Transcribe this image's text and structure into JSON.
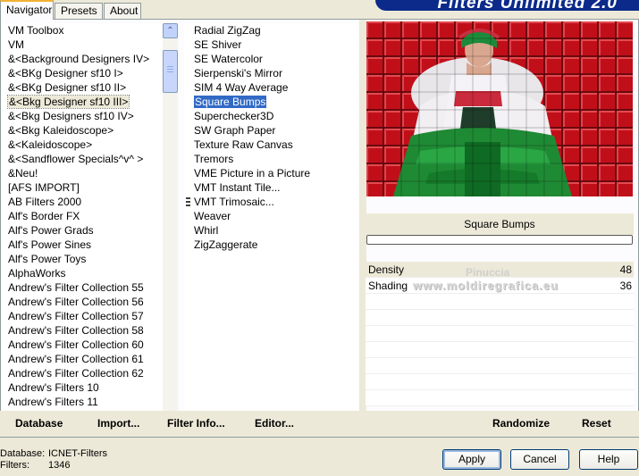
{
  "app": {
    "banner_title": "Filters Unlimited 2.0"
  },
  "tabs": [
    {
      "label": "Navigator",
      "active": true
    },
    {
      "label": "Presets",
      "active": false
    },
    {
      "label": "About",
      "active": false
    }
  ],
  "categories": [
    "VM Toolbox",
    "VM",
    "&<Background Designers IV>",
    "&<BKg Designer sf10 I>",
    "&<BKg Designer sf10 II>",
    "&<Bkg Designer sf10 III>",
    "&<Bkg Designers sf10 IV>",
    "&<Bkg Kaleidoscope>",
    "&<Kaleidoscope>",
    "&<Sandflower Specials^v^ >",
    "&Neu!",
    "[AFS IMPORT]",
    "AB Filters 2000",
    "Alf's Border FX",
    "Alf's Power Grads",
    "Alf's Power Sines",
    "Alf's Power Toys",
    "AlphaWorks",
    "Andrew's Filter Collection 55",
    "Andrew's Filter Collection 56",
    "Andrew's Filter Collection 57",
    "Andrew's Filter Collection 58",
    "Andrew's Filter Collection 60",
    "Andrew's Filter Collection 61",
    "Andrew's Filter Collection 62",
    "Andrew's Filters 10",
    "Andrew's Filters 11"
  ],
  "selected_category_index": 5,
  "filters": [
    "Radial ZigZag",
    "SE Shiver",
    "SE Watercolor",
    "Sierpenski's Mirror",
    "SIM 4 Way Average",
    "Square Bumps",
    "Superchecker3D",
    "SW Graph Paper",
    "Texture Raw Canvas",
    "Tremors",
    "VME Picture in a Picture",
    "VMT Instant Tile...",
    "VMT Trimosaic...",
    "Weaver",
    "Whirl",
    "ZigZaggerate"
  ],
  "selected_filter_index": 5,
  "scroll_up_glyph": "⌃",
  "scroll_down_glyph": "⌄",
  "preview": {
    "filter_name": "Square Bumps"
  },
  "params": [
    {
      "label": "Density",
      "value": "48"
    },
    {
      "label": "Shading",
      "value": "36"
    }
  ],
  "watermark": {
    "line1": "Pinuccia",
    "line2": "www.moldiregrafica.eu"
  },
  "toolbar": {
    "database": "Database",
    "import": "Import...",
    "filter_info": "Filter Info...",
    "editor": "Editor...",
    "randomize": "Randomize",
    "reset": "Reset"
  },
  "status": {
    "database_label": "Database:",
    "database_value": "ICNET-Filters",
    "filters_label": "Filters:",
    "filters_value": "1346"
  },
  "buttons": {
    "apply": "Apply",
    "cancel": "Cancel",
    "help": "Help"
  },
  "colors": {
    "selection": "#316ac5",
    "banner": "#0b2a8a",
    "preview_bg": "#c0101a"
  }
}
